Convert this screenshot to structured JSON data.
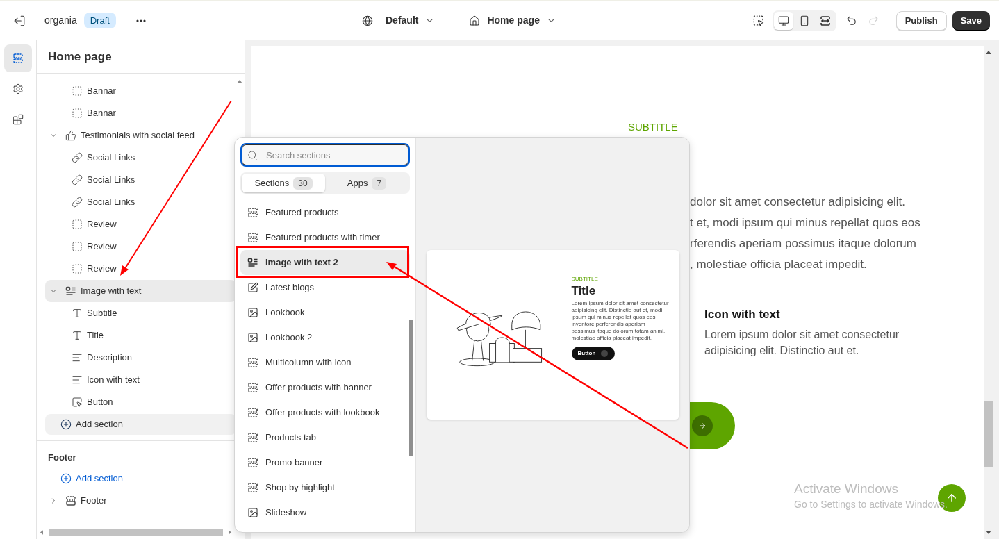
{
  "topbar": {
    "store": "organia",
    "status": "Draft",
    "theme": "Default",
    "page": "Home page",
    "devices": [
      {
        "kind": "desktop",
        "selected": true
      },
      {
        "kind": "mobile",
        "selected": false
      },
      {
        "kind": "fullwidth",
        "selected": false
      }
    ],
    "undo": {
      "disabled": false
    },
    "redo": {
      "disabled": true
    },
    "buttons": [
      {
        "label": "Publish",
        "kind": "secondary"
      },
      {
        "label": "Save",
        "kind": "primary"
      }
    ]
  },
  "rail": [
    {
      "kind": "sections",
      "selected": true
    },
    {
      "kind": "settings",
      "selected": false
    },
    {
      "kind": "apps",
      "selected": false
    }
  ],
  "sidebar": {
    "title": "Home page",
    "tree": [
      {
        "label": "Bannar",
        "kind": "frame",
        "selected": false
      },
      {
        "label": "Bannar",
        "kind": "frame",
        "selected": false
      },
      {
        "label": "Testimonials with social feed",
        "kind": "testimonials",
        "expanded": true,
        "selected": false,
        "children": [
          {
            "label": "Social Links",
            "kind": "link",
            "selected": false
          },
          {
            "label": "Social Links",
            "kind": "link",
            "selected": false
          },
          {
            "label": "Social Links",
            "kind": "link",
            "selected": false
          },
          {
            "label": "Review",
            "kind": "frame",
            "selected": false
          },
          {
            "label": "Review",
            "kind": "frame",
            "selected": false
          },
          {
            "label": "Review",
            "kind": "frame",
            "selected": false
          }
        ]
      },
      {
        "label": "Image with text",
        "kind": "imagetext",
        "expanded": true,
        "selected": true,
        "children": [
          {
            "label": "Subtitle",
            "kind": "heading",
            "selected": false
          },
          {
            "label": "Title",
            "kind": "heading",
            "selected": false
          },
          {
            "label": "Description",
            "kind": "paragraph",
            "selected": false
          },
          {
            "label": "Icon with text",
            "kind": "paragraph",
            "selected": false
          },
          {
            "label": "Button",
            "kind": "pointer",
            "selected": false
          }
        ]
      }
    ],
    "add_section": "Add section",
    "footer": {
      "heading": "Footer",
      "add_section": "Add section",
      "tree": [
        {
          "label": "Footer",
          "kind": "footer",
          "expanded": false,
          "selected": false
        }
      ]
    }
  },
  "picker": {
    "search": {
      "placeholder": "Search sections"
    },
    "tabs": [
      {
        "label": "Sections",
        "count": "30",
        "selected": true
      },
      {
        "label": "Apps",
        "count": "7",
        "selected": false
      }
    ],
    "items": [
      {
        "label": "Featured products",
        "kind": "section",
        "selected": false
      },
      {
        "label": "Featured products with timer",
        "kind": "section",
        "selected": false
      },
      {
        "label": "Image with text 2",
        "kind": "imagetext",
        "selected": true
      },
      {
        "label": "Latest blogs",
        "kind": "blog",
        "selected": false
      },
      {
        "label": "Lookbook",
        "kind": "lookbook",
        "selected": false
      },
      {
        "label": "Lookbook 2",
        "kind": "lookbook",
        "selected": false
      },
      {
        "label": "Multicolumn with icon",
        "kind": "section",
        "selected": false
      },
      {
        "label": "Offer products with banner",
        "kind": "section",
        "selected": false
      },
      {
        "label": "Offer products with lookbook",
        "kind": "section",
        "selected": false
      },
      {
        "label": "Products tab",
        "kind": "section",
        "selected": false
      },
      {
        "label": "Promo banner",
        "kind": "section",
        "selected": false
      },
      {
        "label": "Shop by highlight",
        "kind": "section",
        "selected": false
      },
      {
        "label": "Slideshow",
        "kind": "slideshow",
        "selected": false
      }
    ],
    "preview": {
      "subtitle": "SUBTITLE",
      "title": "Title",
      "text": "Lorem ipsum dolor sit amet consectetur adipisicing elit. Distinctio aut et, modi ipsum qui minus repellat quos eos inventore perferendis aperiam possimus itaque dolorum totam animi, molestiae officia placeat impedit.",
      "button": "Button"
    }
  },
  "canvas": {
    "subtitle": "SUBTITLE",
    "paragraph_lines": [
      "dolor sit amet consectetur adipisicing elit.",
      "t et, modi ipsum qui minus repellat quos eos",
      "rferendis aperiam possimus itaque dolorum",
      ", molestiae officia placeat impedit."
    ],
    "feature": {
      "title": "Icon with text",
      "text": "Lorem ipsum dolor sit amet consectetur adipisicing elit. Distinctio aut et."
    }
  },
  "notice": {
    "title": "Activate Windows",
    "text": "Go to Settings to activate Windows."
  }
}
